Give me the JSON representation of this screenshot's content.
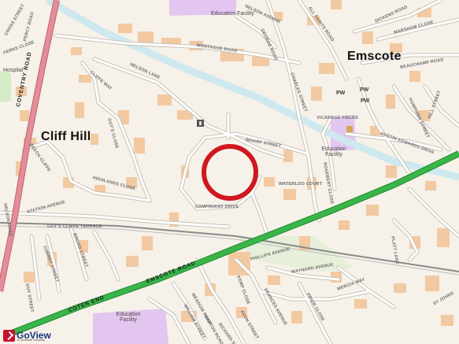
{
  "map": {
    "areas": [
      "Cliff Hill",
      "Emscote"
    ],
    "main_roads": [
      "COVENTRY ROAD",
      "EMSCOTE ROAD",
      "COTEN END"
    ],
    "streets": [
      "CROSS STREET",
      "PERCY ROAD",
      "FERNS CLOSE",
      "CLIFFE WAY",
      "NELSON LANE",
      "GUY'S CLOSE",
      "BEECH CLIFFE",
      "HIGHLANDS CLOSE",
      "STATION AVENUE",
      "GUY'S CLIFFE TERRACE",
      "BROAD STREET",
      "CHERRY STREET",
      "GUY STREET",
      "WHARF STREET",
      "CAMPRIANO DRIVE",
      "WATERLOO COURT",
      "NELSON AVENUE",
      "MONTAGUE ROAD",
      "GEORGE ROAD",
      "CHARLES STREET",
      "ALL SAINTS ROAD",
      "DICKENS ROAD",
      "MARSHAM CLOSE",
      "BEAUCHAMP ROAD",
      "HILL STREET",
      "HUMPHRIS STREET",
      "VICARAGE FIELDS",
      "AUSTIN EDWARDS DRIVE",
      "ROSEBERY CLOSE",
      "KEMP CLOSE",
      "PHILLIPS AVENUE",
      "MAYNARD AVENUE",
      "FRANCES AVENUE",
      "PRIOR CLOSE",
      "MERCIA WAY",
      "AVON STREET",
      "NAPTON ROAD",
      "RICHARD STREET",
      "WILLIAM STREET",
      "MEADOW ROAD",
      "PLATT LANE",
      "NELSON ROAD",
      "ST JOHNS"
    ],
    "facilities": [
      "Education Facility",
      "Education Facility",
      "Education Facility",
      "Hospital"
    ],
    "worship": [
      "PW",
      "PW",
      "PW"
    ],
    "roads_label": {
      "coventry": "COVENTRY ROAD",
      "emscote": "EMSCOTE ROAD",
      "coten": "COTEN END"
    }
  },
  "marker": {
    "type": "circle",
    "color": "#d0171f"
  },
  "colors": {
    "background": "#f6f1e9",
    "buildings": "#f2c9a1",
    "water": "#cde8ef",
    "rail": "#8a8a8a",
    "main_road_green": "#39b54a",
    "main_road_pink": "#e48d9a",
    "education": "#e3c6ef",
    "green_space": "#d6ecc7"
  },
  "logo": {
    "name": "GoView",
    "tagline": "A Landmark Company"
  }
}
